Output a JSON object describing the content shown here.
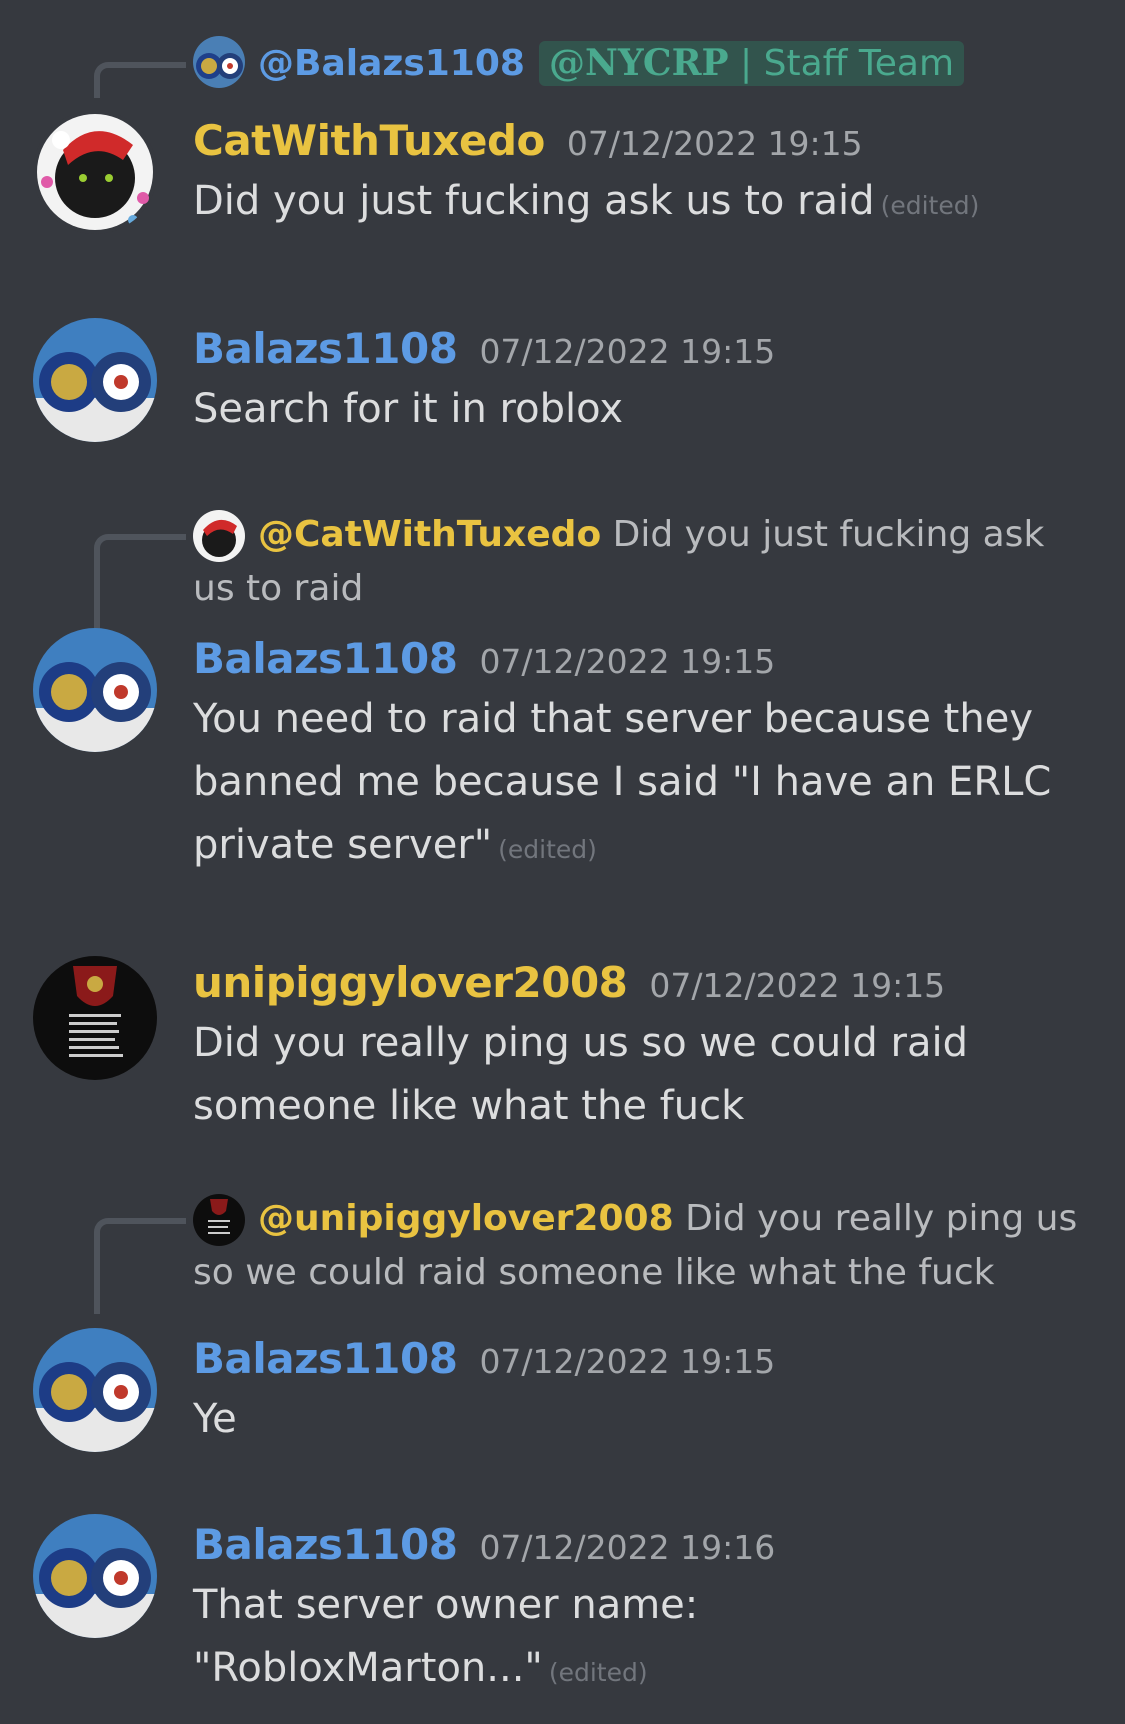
{
  "replies": {
    "r1": {
      "mention": "@Balazs1108",
      "role_prefix": "@NYCRP",
      "role_sep": "|",
      "role_name": "Staff Team"
    },
    "r2": {
      "mention": "@CatWithTuxedo",
      "text": "Did you just fucking ask us to raid"
    },
    "r3": {
      "mention": "@unipiggylover2008",
      "text": "Did you really ping us so we could raid someone like what the fuck"
    }
  },
  "messages": [
    {
      "author": "CatWithTuxedo",
      "timestamp": "07/12/2022 19:15",
      "text": "Did you just fucking ask us to raid",
      "edited": "(edited)"
    },
    {
      "author": "Balazs1108",
      "timestamp": "07/12/2022 19:15",
      "text": "Search for it in roblox"
    },
    {
      "author": "Balazs1108",
      "timestamp": "07/12/2022 19:15",
      "text": "You need to raid that server because they banned me because I said \"I have an ERLC private server\"",
      "edited": "(edited)"
    },
    {
      "author": "unipiggylover2008",
      "timestamp": "07/12/2022 19:15",
      "text": "Did you really ping us so we could raid someone like what the fuck"
    },
    {
      "author": "Balazs1108",
      "timestamp": "07/12/2022 19:15",
      "text": "Ye"
    },
    {
      "author": "Balazs1108",
      "timestamp": "07/12/2022 19:16",
      "text": "That server owner name: \"RobloxMarton...\"",
      "edited": "(edited)"
    }
  ],
  "colors": {
    "background": "#36393f",
    "name_yellow": "#e9c341",
    "name_blue": "#5d9be4",
    "role": "#4aa98e"
  }
}
